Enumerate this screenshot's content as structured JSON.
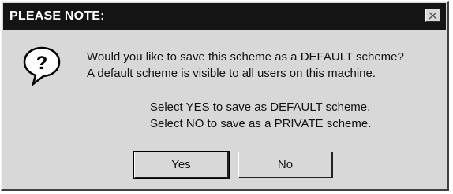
{
  "dialog": {
    "title": "PLEASE NOTE:",
    "icon": "question-icon",
    "message_lines": [
      "Would you like to save this scheme as a DEFAULT scheme?",
      "A default scheme is visible to all users on this machine."
    ],
    "instruction_lines": [
      "Select YES to save as DEFAULT scheme.",
      "Select NO to save as a PRIVATE scheme."
    ],
    "buttons": {
      "yes_label": "Yes",
      "no_label": "No"
    }
  }
}
